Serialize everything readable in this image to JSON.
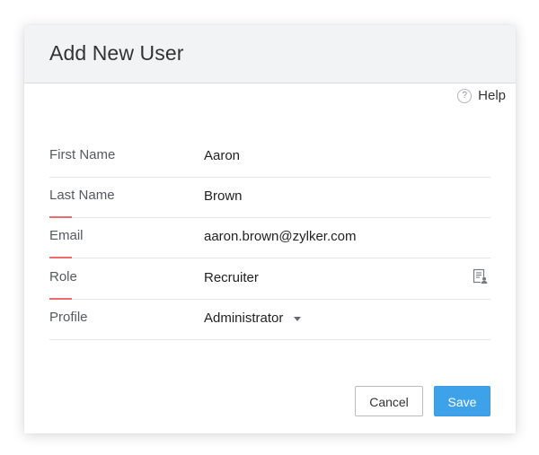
{
  "dialog": {
    "title": "Add New User",
    "help_label": "Help",
    "help_icon": "question-circle-icon"
  },
  "fields": {
    "first_name": {
      "label": "First Name",
      "value": "Aaron",
      "required": false
    },
    "last_name": {
      "label": "Last Name",
      "value": "Brown",
      "required": true
    },
    "email": {
      "label": "Email",
      "value": "aaron.brown@zylker.com",
      "required": true
    },
    "role": {
      "label": "Role",
      "value": "Recruiter",
      "required": true,
      "icon": "role-lookup-icon"
    },
    "profile": {
      "label": "Profile",
      "value": "Administrator",
      "required": false,
      "icon": "caret-down-icon"
    }
  },
  "buttons": {
    "cancel_label": "Cancel",
    "save_label": "Save"
  },
  "colors": {
    "header_bg": "#f2f3f4",
    "required_marker": "#ef6b6b",
    "primary": "#3ea2eb"
  }
}
